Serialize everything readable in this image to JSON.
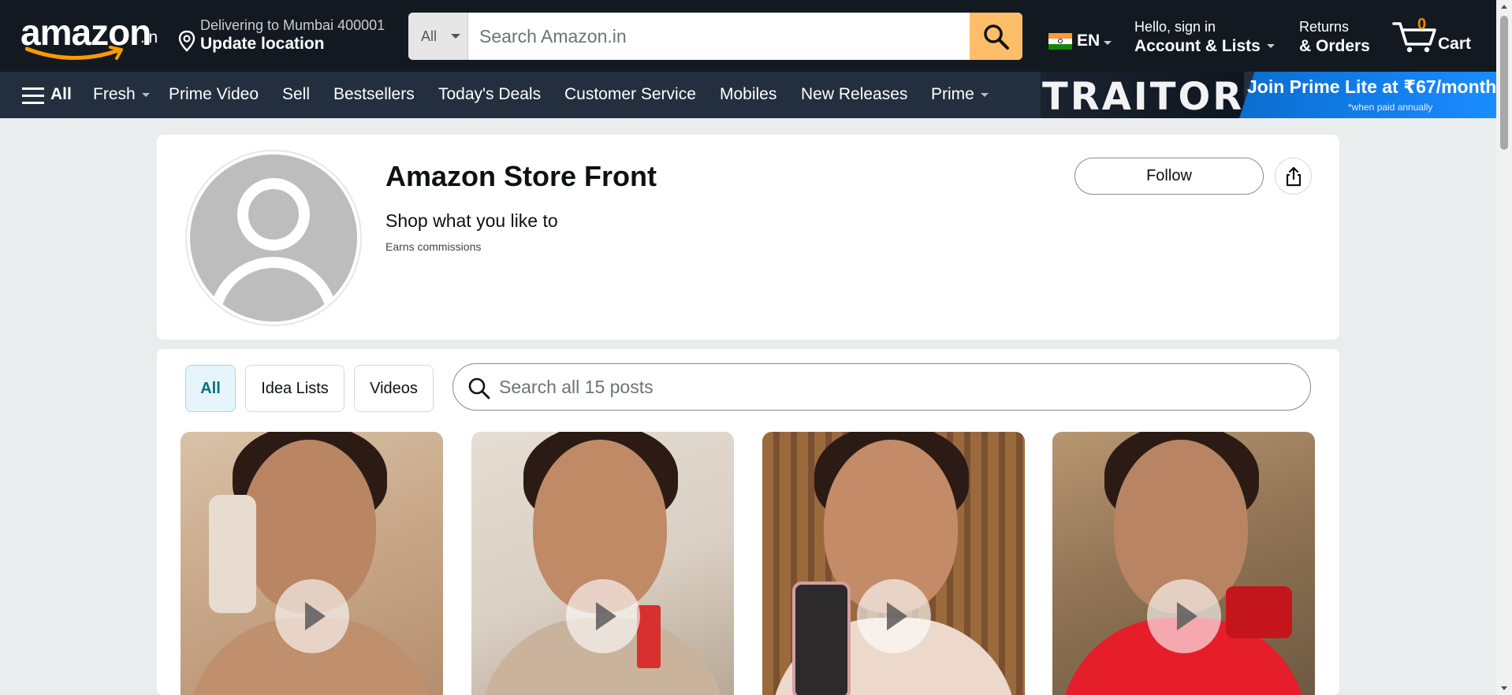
{
  "header": {
    "logo_text": "amazon",
    "logo_tld": ".in",
    "location": {
      "line1": "Delivering to Mumbai 400001",
      "line2": "Update location"
    },
    "search": {
      "category": "All",
      "placeholder": "Search Amazon.in"
    },
    "language": "EN",
    "account": {
      "line1": "Hello, sign in",
      "line2": "Account & Lists"
    },
    "orders": {
      "line1": "Returns",
      "line2": "& Orders"
    },
    "cart": {
      "count": "0",
      "label": "Cart"
    }
  },
  "subnav": {
    "all_label": "All",
    "items": [
      "Fresh",
      "Prime Video",
      "Sell",
      "Bestsellers",
      "Today's Deals",
      "Customer Service",
      "Mobiles",
      "New Releases",
      "Prime"
    ],
    "promo": {
      "brand": "TRAITOR",
      "line1": "Join Prime Lite at ₹67/month*",
      "line2": "*when paid annually"
    }
  },
  "profile": {
    "title": "Amazon Store Front",
    "subtitle": "Shop what you like to",
    "note": "Earns commissions",
    "follow_label": "Follow"
  },
  "posts": {
    "tabs": [
      "All",
      "Idea Lists",
      "Videos"
    ],
    "active_tab": "All",
    "search_placeholder": "Search all 15 posts"
  },
  "colors": {
    "nav_top": "#131921",
    "nav_sub": "#232f3e",
    "search_button": "#febd69",
    "active_tab_text": "#007185",
    "cart_count": "#f08804"
  }
}
